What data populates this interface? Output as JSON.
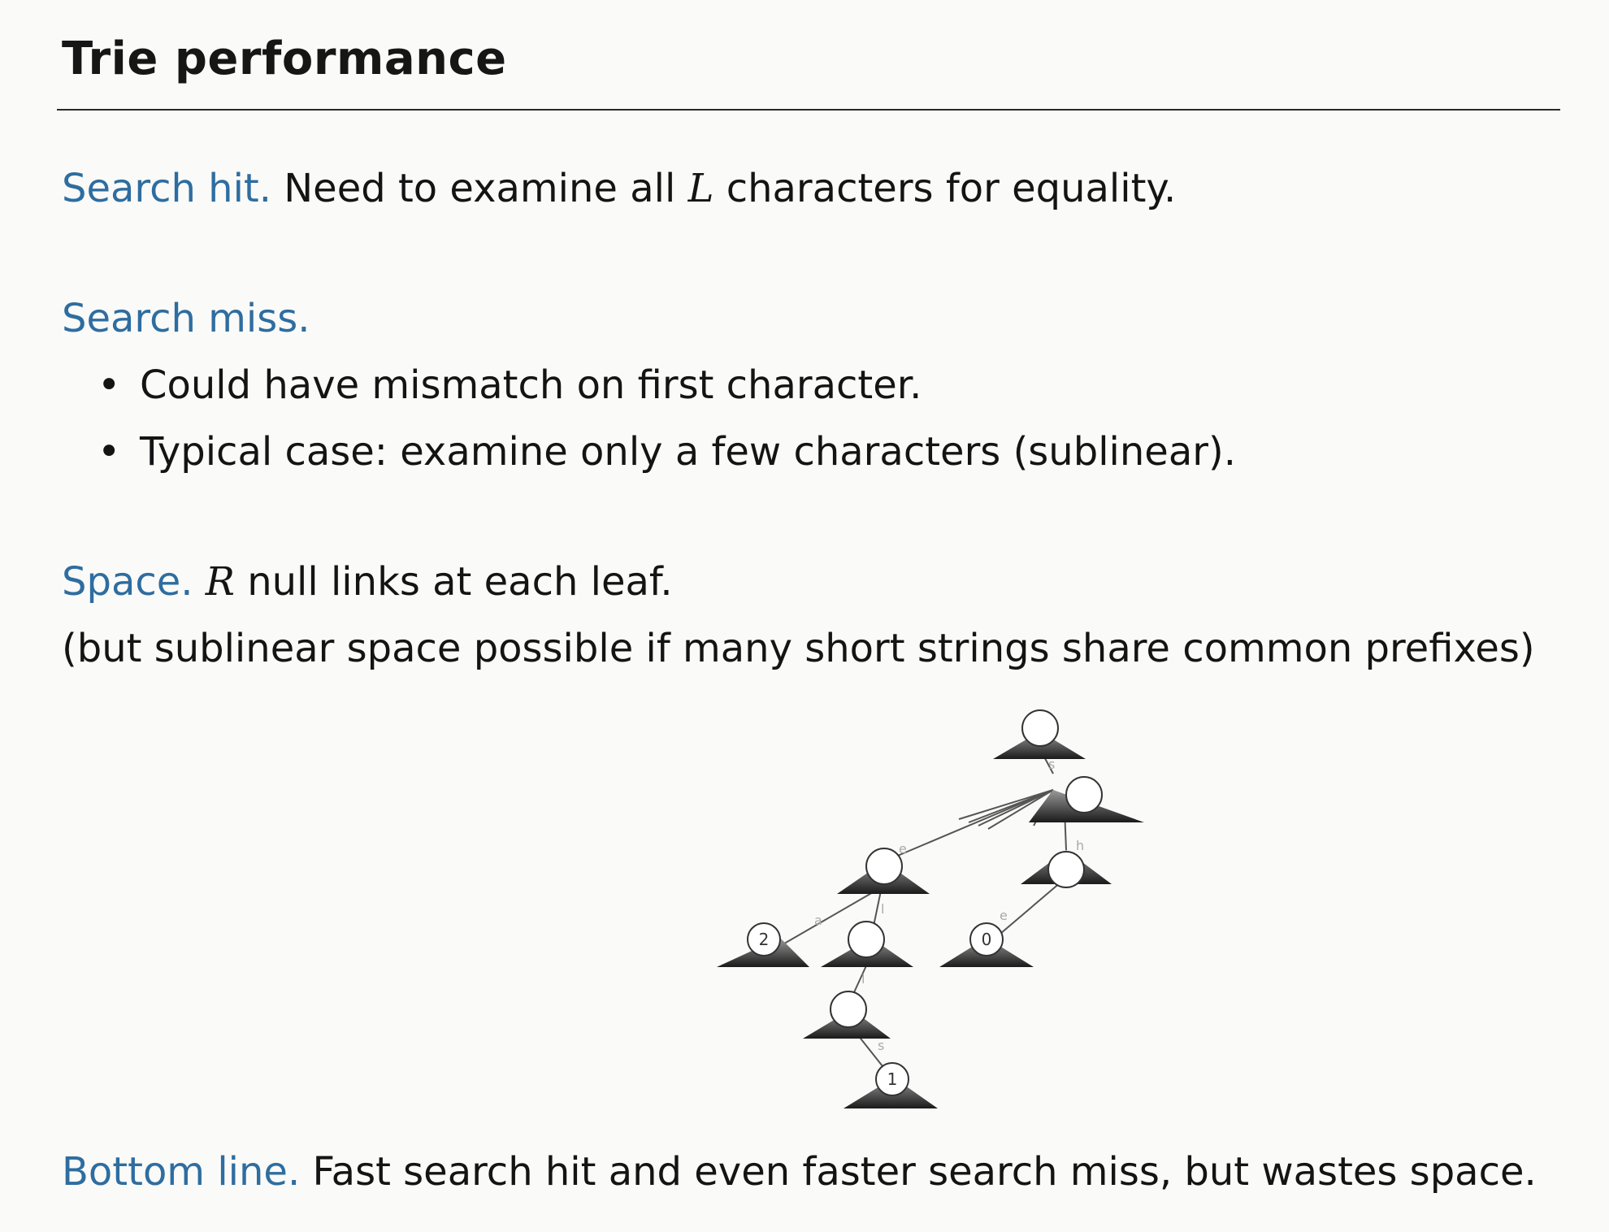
{
  "title": "Trie performance",
  "search_hit": {
    "term": "Search hit.",
    "pre": "Need to examine all ",
    "var": "L",
    "post": " characters for equality."
  },
  "search_miss": {
    "term": "Search miss.",
    "bullets": [
      "Could have mismatch on first character.",
      "Typical case:  examine only a few characters (sublinear)."
    ]
  },
  "space": {
    "term": "Space.",
    "var": "R",
    "text": " null links at each leaf.",
    "note": "(but sublinear space possible if many short strings share common prefixes)"
  },
  "bottom_line": {
    "term": "Bottom line.",
    "text": "Fast search hit and even faster search miss, but wastes space."
  },
  "trie": {
    "edge_labels": {
      "s": "s",
      "e": "e",
      "h": "h",
      "a": "a",
      "l1": "l",
      "e2": "e",
      "l2": "l",
      "s2": "s"
    },
    "values": {
      "a": "2",
      "e": "0",
      "s": "1"
    }
  }
}
